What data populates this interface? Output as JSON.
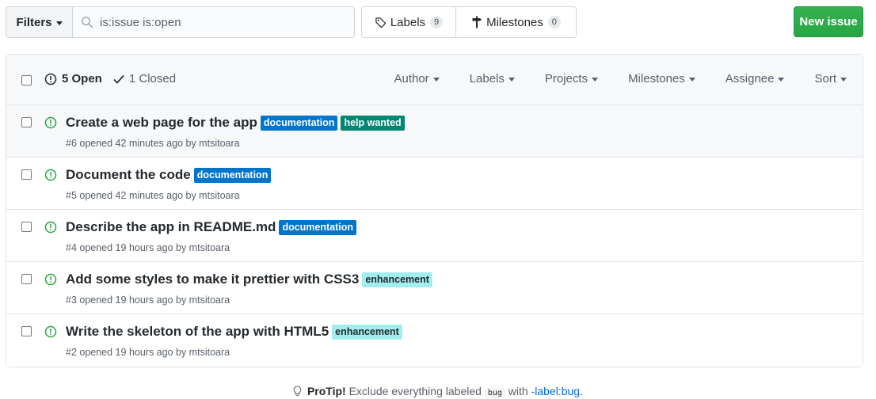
{
  "toolbar": {
    "filters_label": "Filters",
    "search_value": "is:issue is:open",
    "labels_label": "Labels",
    "labels_count": "9",
    "milestones_label": "Milestones",
    "milestones_count": "0",
    "new_issue_label": "New issue"
  },
  "header": {
    "open_label": "5 Open",
    "closed_label": "1 Closed",
    "menus": [
      "Author",
      "Labels",
      "Projects",
      "Milestones",
      "Assignee",
      "Sort"
    ]
  },
  "issues": [
    {
      "title": "Create a web page for the app",
      "labels": [
        {
          "name": "documentation",
          "bg": "#0075ca",
          "fg": "#ffffff"
        },
        {
          "name": "help wanted",
          "bg": "#008672",
          "fg": "#ffffff"
        }
      ],
      "meta": "#6 opened 42 minutes ago by mtsitoara"
    },
    {
      "title": "Document the code",
      "labels": [
        {
          "name": "documentation",
          "bg": "#0075ca",
          "fg": "#ffffff"
        }
      ],
      "meta": "#5 opened 42 minutes ago by mtsitoara"
    },
    {
      "title": "Describe the app in README.md",
      "labels": [
        {
          "name": "documentation",
          "bg": "#0075ca",
          "fg": "#ffffff"
        }
      ],
      "meta": "#4 opened 19 hours ago by mtsitoara"
    },
    {
      "title": "Add some styles to make it prettier with CSS3",
      "labels": [
        {
          "name": "enhancement",
          "bg": "#a2eeef",
          "fg": "#24292e"
        }
      ],
      "meta": "#3 opened 19 hours ago by mtsitoara"
    },
    {
      "title": "Write the skeleton of the app with HTML5",
      "labels": [
        {
          "name": "enhancement",
          "bg": "#a2eeef",
          "fg": "#24292e"
        }
      ],
      "meta": "#2 opened 19 hours ago by mtsitoara"
    }
  ],
  "protip": {
    "lead": "ProTip!",
    "text_before": "Exclude everything labeled",
    "code": "bug",
    "text_middle": "with",
    "link": "-label:bug",
    "text_after": "."
  },
  "colors": {
    "open_icon": "#28a745",
    "new_issue_bg": "#2ea44f",
    "link": "#0366d6"
  },
  "icons": [
    "search-icon",
    "tag-icon",
    "milestone-icon",
    "issue-opened-icon",
    "check-icon",
    "light-bulb-icon",
    "chevron-down-icon"
  ]
}
